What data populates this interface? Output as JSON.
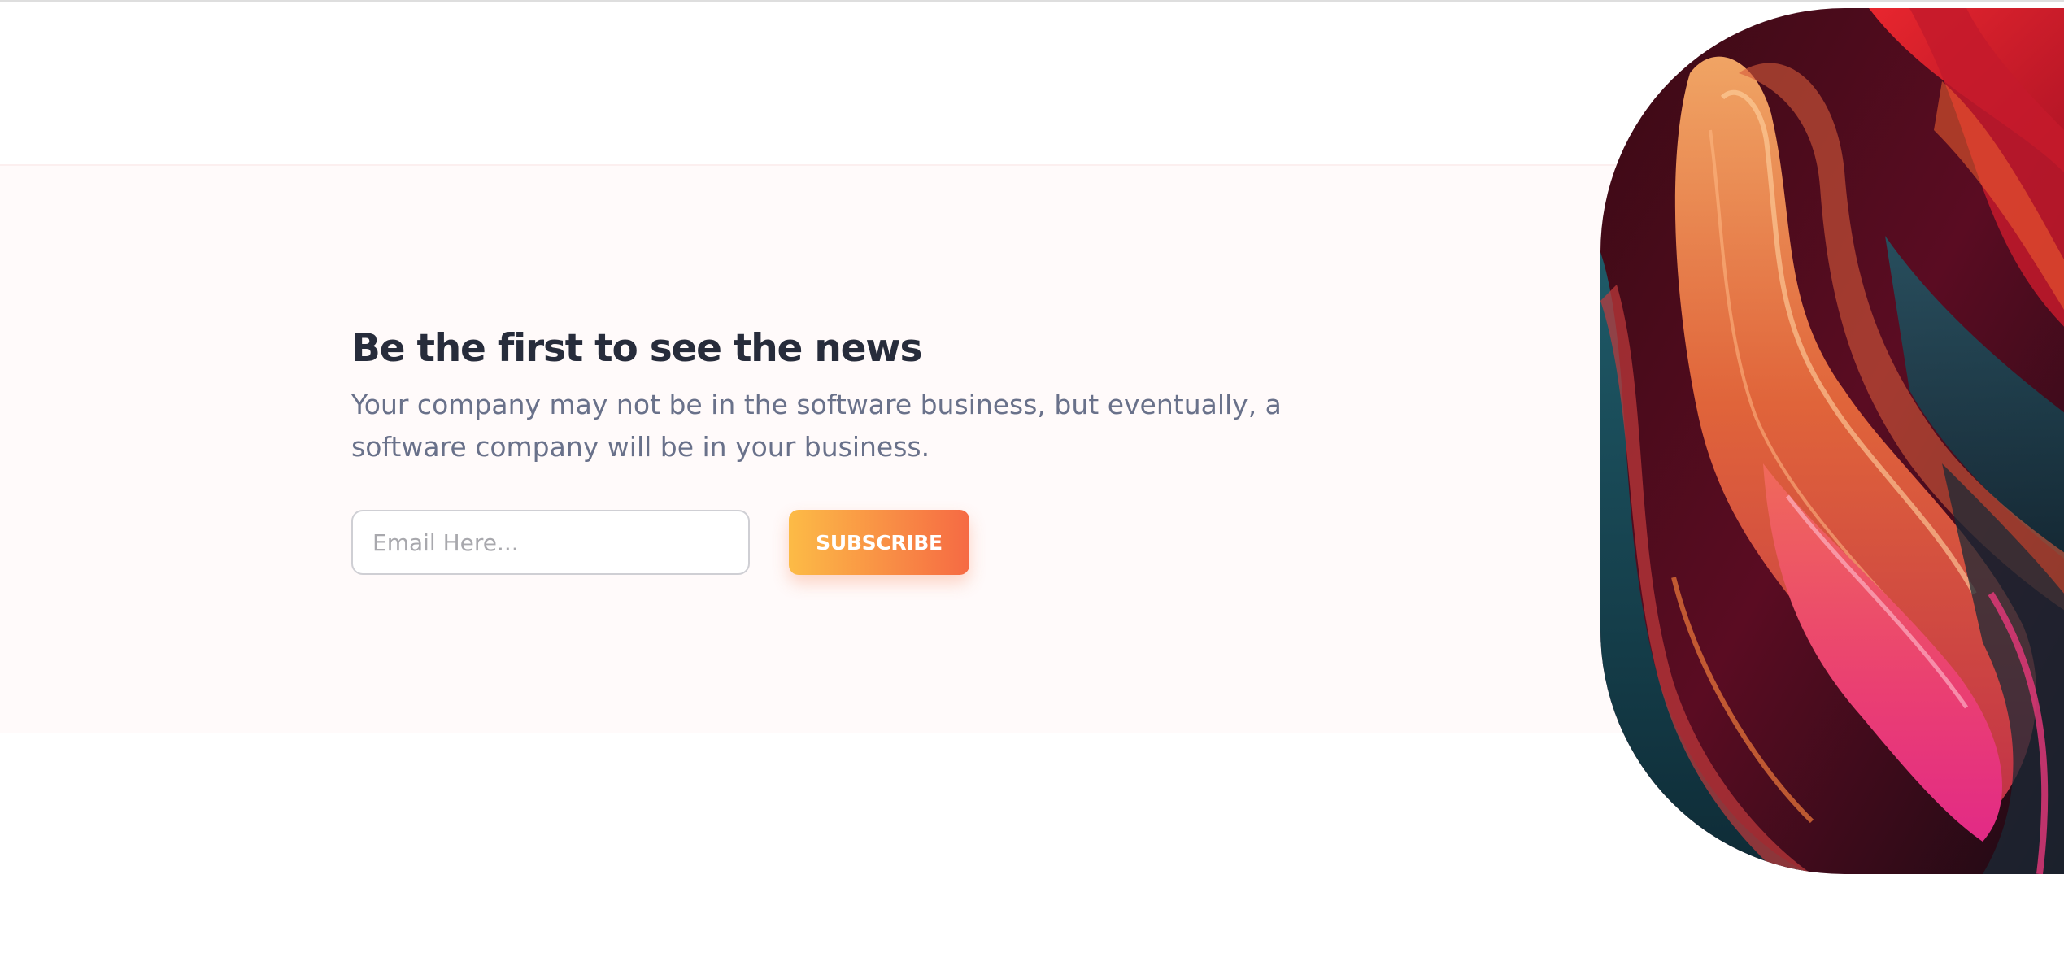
{
  "newsletter": {
    "headline": "Be the first to see the news",
    "subtitle": "Your company may not be in the software business, but eventually, a software company will be in your business.",
    "email_placeholder": "Email Here...",
    "subscribe_label": "SUBSCRIBE"
  },
  "colors": {
    "band_background": "#fffafa",
    "headline": "#272c3b",
    "subtitle": "#69718a",
    "button_gradient_start": "#fcbb46",
    "button_gradient_end": "#f66a44"
  }
}
